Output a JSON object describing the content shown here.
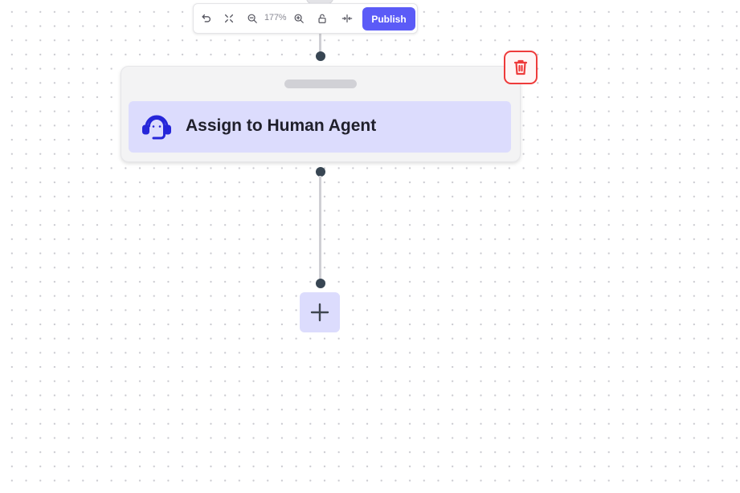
{
  "toolbar": {
    "zoom_label": "177%",
    "publish_label": "Publish",
    "icons": [
      "undo-icon",
      "fit-view-icon",
      "zoom-out-icon",
      "zoom-in-icon",
      "unlock-icon",
      "center-align-icon"
    ],
    "accent_color": "#5b5bf7"
  },
  "node": {
    "title": "Assign to Human Agent",
    "icon": "headset-agent-icon",
    "icon_color": "#2626d9",
    "card_color": "#dcdcfd"
  },
  "delete_button": {
    "icon": "trash-icon",
    "color": "#ee3b3b"
  },
  "add_button": {
    "icon": "plus-icon"
  }
}
